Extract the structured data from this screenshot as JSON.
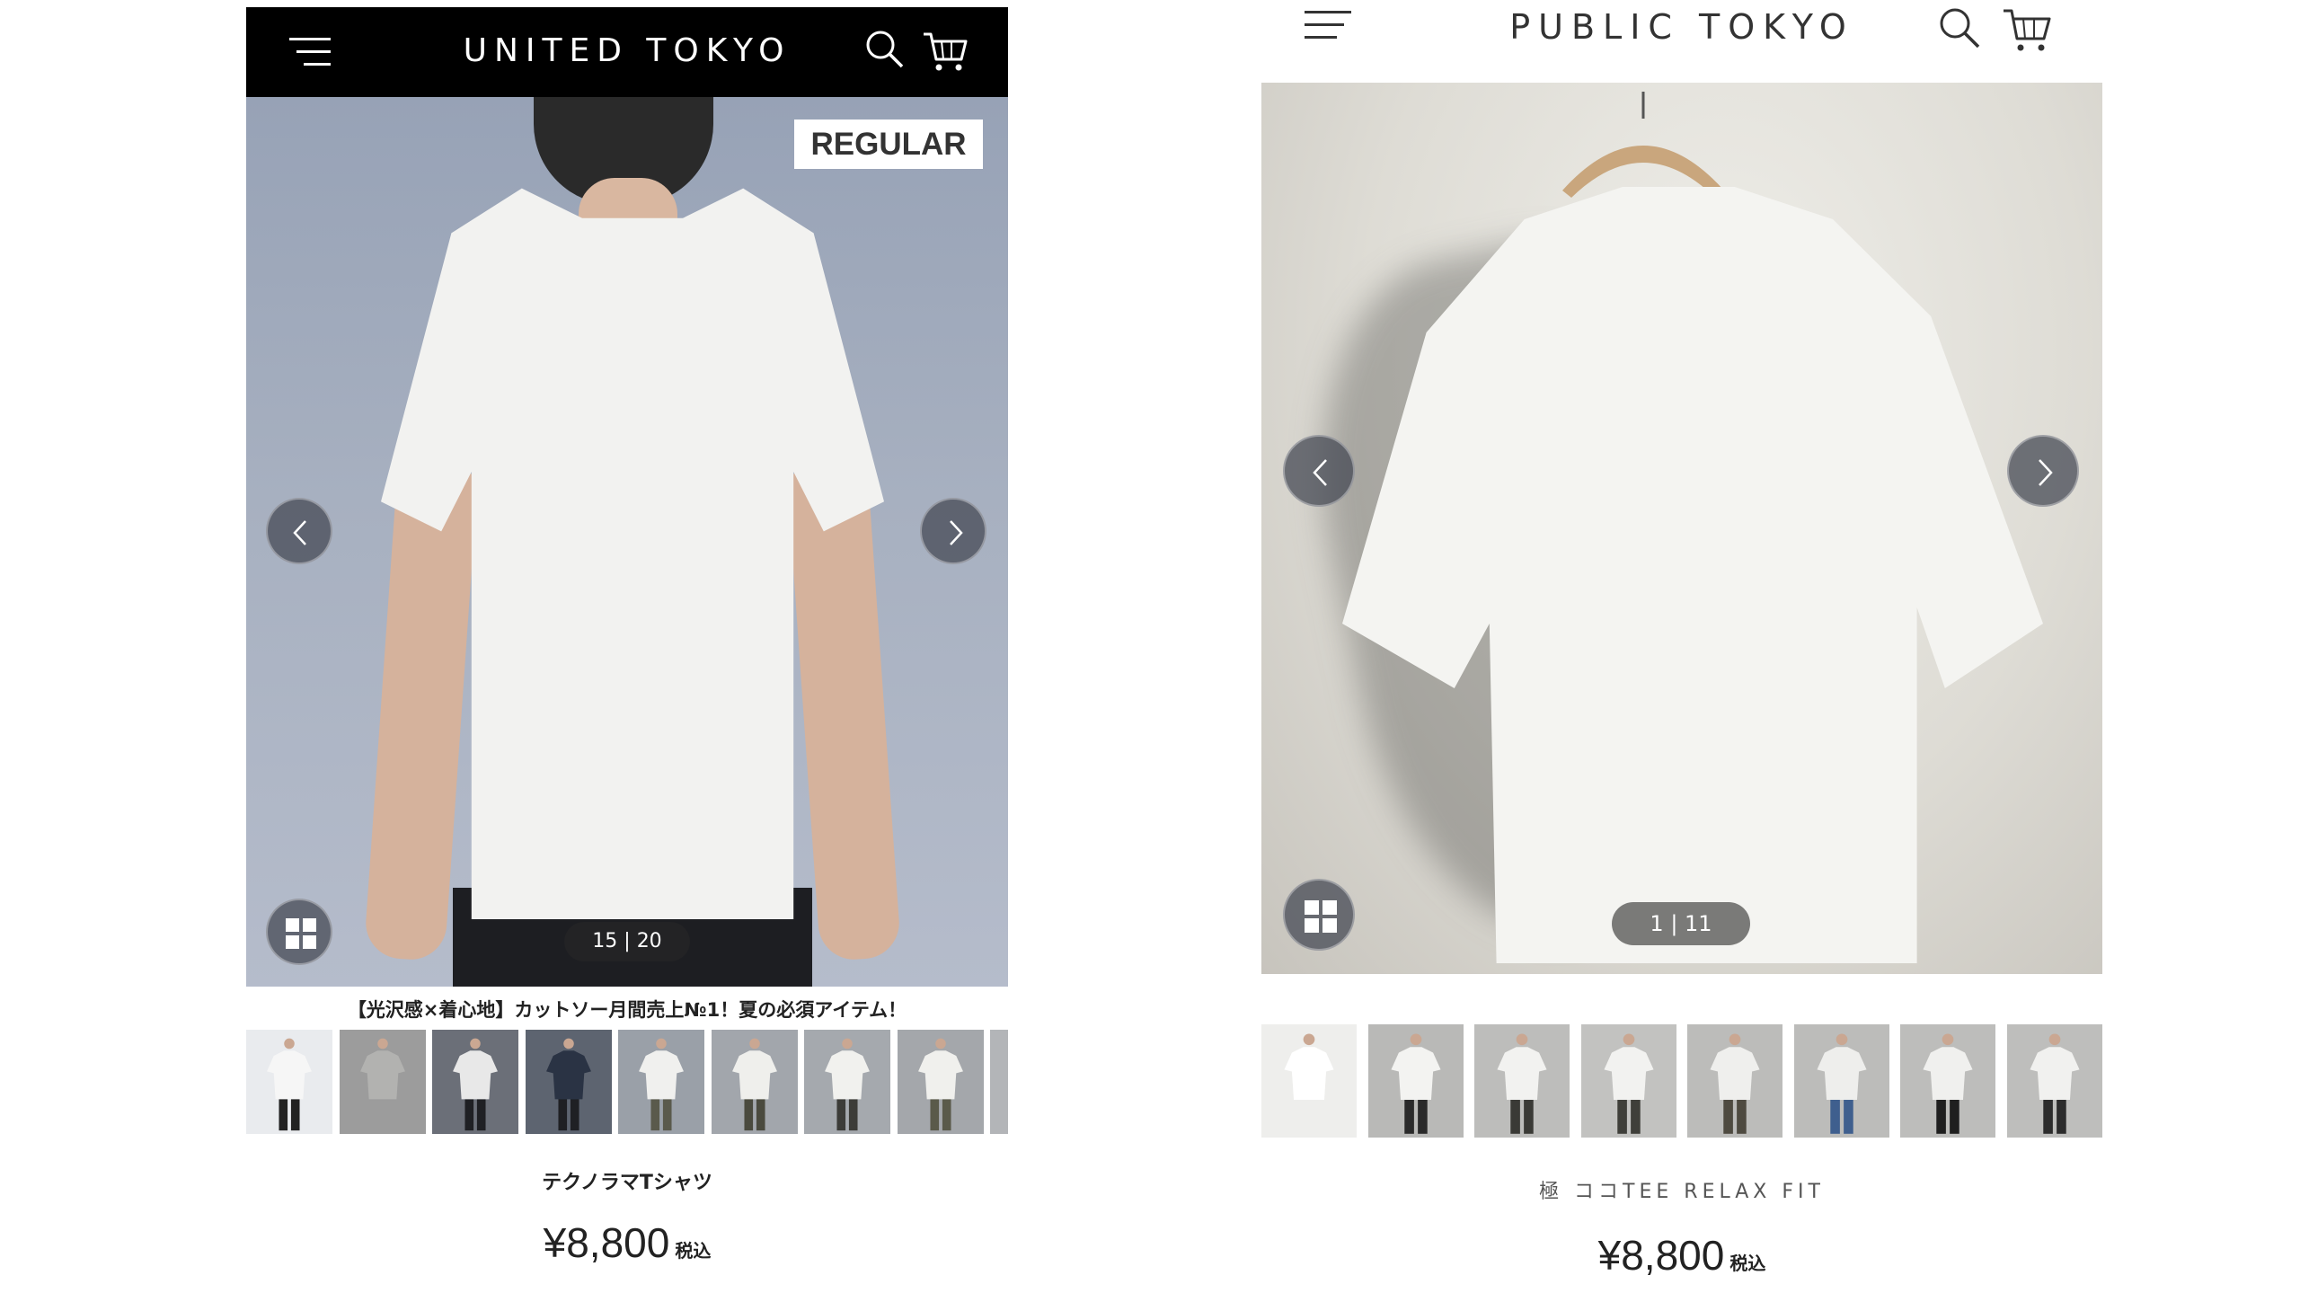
{
  "left": {
    "logo": "UNITED TOKYO",
    "badge": "REGULAR",
    "counter": "15 | 20",
    "caption": "【光沢感×着心地】カットソー月間売上№1！夏の必須アイテム！",
    "product_name": "テクノラマTシャツ",
    "price": "¥8,800",
    "tax_label": "税込",
    "thumbnails": [
      {
        "bg": "#e9ebee",
        "shirt": "#f6f6f6",
        "legs": "#222"
      },
      {
        "bg": "#9c9c9c",
        "shirt": "#b2b2b0",
        "legs": "#9c9c9c"
      },
      {
        "bg": "#6b6f78",
        "shirt": "#e8e8e8",
        "legs": "#1f2024"
      },
      {
        "bg": "#5d6470",
        "shirt": "#2a3344",
        "legs": "#1f2024"
      },
      {
        "bg": "#9aa0a8",
        "shirt": "#f0f0ee",
        "legs": "#5a5a4c"
      },
      {
        "bg": "#a2a6ac",
        "shirt": "#efefec",
        "legs": "#4a4a3e"
      },
      {
        "bg": "#a5a9ae",
        "shirt": "#f1f1ee",
        "legs": "#3c3c38"
      },
      {
        "bg": "#a4a7ab",
        "shirt": "#f0f0ed",
        "legs": "#5a5a4a"
      },
      {
        "bg": "#b3b5b8",
        "shirt": "#e6e6e3",
        "legs": "#444"
      }
    ]
  },
  "right": {
    "logo": "PUBLIC TOKYO",
    "counter": "1 | 11",
    "product_name": "極 ココTEE RELAX FIT",
    "price": "¥8,800",
    "tax_label": "税込",
    "thumbnails": [
      {
        "bg": "#eeeeec",
        "shirt": "#ffffff",
        "legs": "#eeeeec"
      },
      {
        "bg": "#b9b9b7",
        "shirt": "#f3f3f1",
        "legs": "#2a2a2a"
      },
      {
        "bg": "#bdbdbb",
        "shirt": "#f2f2f0",
        "legs": "#3a3a36"
      },
      {
        "bg": "#c2c2c0",
        "shirt": "#f2f2f0",
        "legs": "#3f3f3a"
      },
      {
        "bg": "#bcbcba",
        "shirt": "#efefed",
        "legs": "#4e4a40"
      },
      {
        "bg": "#bcbcba",
        "shirt": "#eeeeec",
        "legs": "#3f5f8e"
      },
      {
        "bg": "#bdbdbb",
        "shirt": "#f0f0ee",
        "legs": "#1f1f1f"
      },
      {
        "bg": "#bebebc",
        "shirt": "#f1f1ef",
        "legs": "#2c2c2c"
      }
    ]
  }
}
